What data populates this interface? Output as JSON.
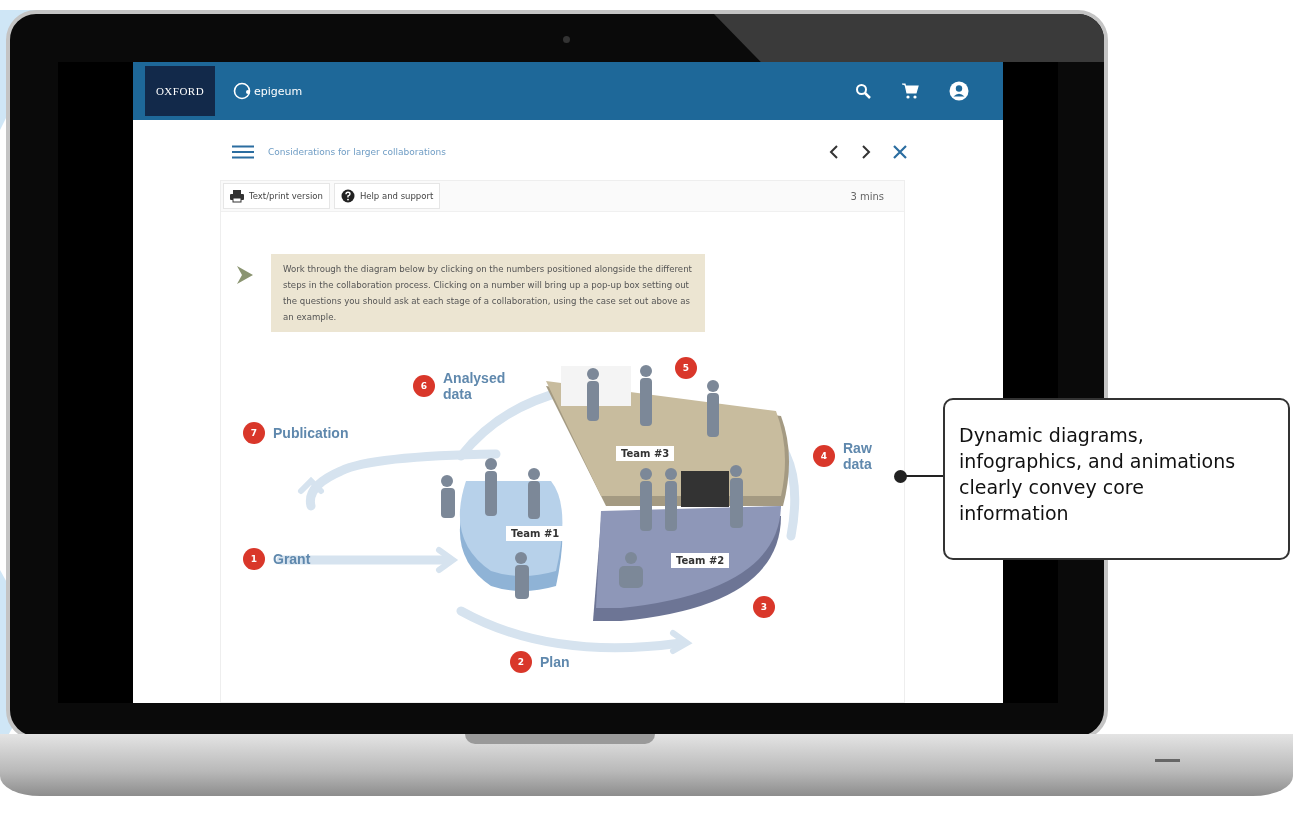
{
  "app": {
    "header": {
      "brand": "OXFORD",
      "product": "epigeum"
    },
    "toolbar": {
      "title": "Considerations for larger collaborations"
    },
    "actions": [
      {
        "kind": "print",
        "label": "Text/print version"
      },
      {
        "kind": "help",
        "label": "Help and support"
      }
    ],
    "duration": "3 mins",
    "instruction": "Work through the diagram below by clicking on the numbers positioned alongside the different steps in the collaboration process. Clicking on a number will bring up a pop-up box setting out the questions you should ask at each stage of a collaboration, using the case set out above as an example.",
    "diagram": {
      "steps": [
        {
          "number": "7",
          "label": "Publication"
        },
        {
          "number": "6",
          "label": "Analysed data"
        },
        {
          "number": "5"
        },
        {
          "number": "4",
          "label": "Raw data"
        },
        {
          "number": "1",
          "label": "Grant"
        },
        {
          "number": "3"
        },
        {
          "number": "2",
          "label": "Plan"
        }
      ],
      "teams": [
        "Team #3",
        "Team #1",
        "Team #2"
      ]
    }
  },
  "callout": {
    "text": "Dynamic diagrams, infographics, and animations clearly convey core information"
  }
}
